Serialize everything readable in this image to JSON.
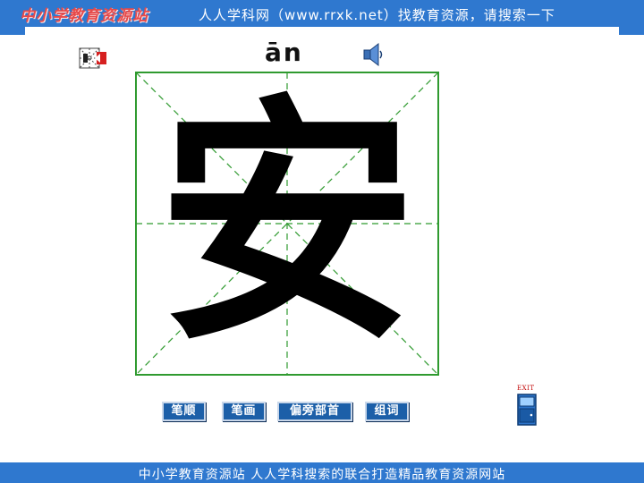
{
  "header": {
    "logo_text": "中小学教育资源站",
    "banner_text": "人人学科网（www.rrxk.net）找教育资源，请搜索一下"
  },
  "lesson": {
    "pinyin": "ān",
    "character": "安"
  },
  "buttons": {
    "stroke_order": "笔顺",
    "strokes": "笔画",
    "radical": "偏旁部首",
    "word_formation": "组词"
  },
  "exit": {
    "label": "EXIT"
  },
  "footer": {
    "text": "中小学教育资源站  人人学科搜索的联合打造精品教育资源网站"
  },
  "colors": {
    "banner": "#2f78cf",
    "grid": "#2f9a2f",
    "button": "#1c5fa8",
    "exit": "#c00000"
  },
  "icons": {
    "stroke_demo": "stroke-demo-icon",
    "speaker": "speaker-icon",
    "exit": "exit-door-icon"
  }
}
